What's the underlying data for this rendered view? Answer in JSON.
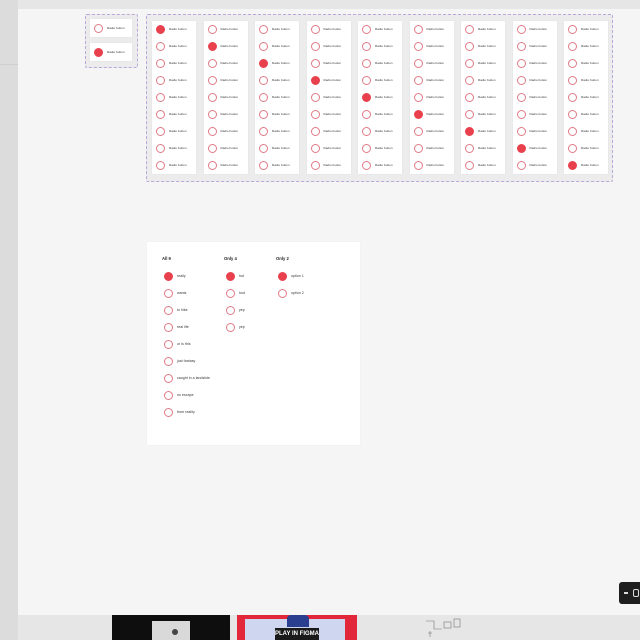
{
  "colors": {
    "accent": "#e8404c",
    "ring": "#e07a86",
    "frame_dashes": "#b9a8d8",
    "canvas": "#f5f5f5"
  },
  "radio_label": "Radio button",
  "component_set": [
    {
      "selected": false
    },
    {
      "selected": true
    }
  ],
  "variants_selected_index": [
    0,
    1,
    2,
    3,
    4,
    5,
    6,
    7,
    8
  ],
  "variants_row_count": 9,
  "example": {
    "columns": [
      {
        "title": "All 9",
        "selected_index": 0,
        "options": [
          "really",
          "wants",
          "to hike",
          "real life",
          "or is this",
          "just fantasy",
          "caught in a landslide",
          "no escape",
          "from reality"
        ]
      },
      {
        "title": "Only 4",
        "selected_index": 0,
        "options": [
          "hut",
          "hud",
          "yep",
          "yep"
        ]
      },
      {
        "title": "Only 2",
        "selected_index": 0,
        "options": [
          "option 1",
          "option 2"
        ]
      }
    ]
  },
  "bottom_banner": {
    "button_label": "PLAY IN FIGMA"
  },
  "icons": [
    "minus-icon",
    "grid-icon"
  ]
}
